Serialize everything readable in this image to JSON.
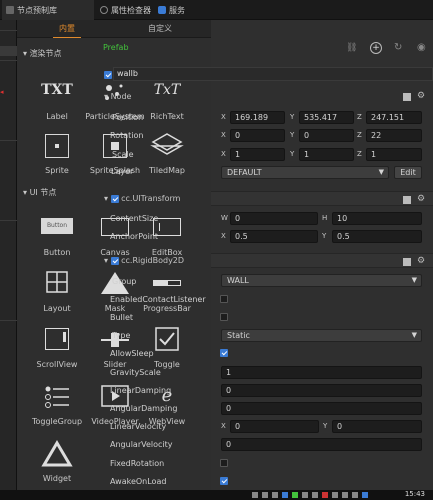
{
  "tabs": {
    "node_library": "节点预制库",
    "inspector": "属性检查器",
    "service": "服务"
  },
  "library": {
    "tabs": [
      "内置",
      "自定义"
    ],
    "prefab_label": "Prefab",
    "render_section": "渲染节点",
    "ui_section": "UI 节点",
    "render_nodes": [
      "Label",
      "ParticleSystem",
      "RichText",
      "Sprite",
      "SpriteSplash",
      "TiledMap"
    ],
    "ui_nodes": [
      "Button",
      "Canvas",
      "EditBox",
      "Layout",
      "Mask",
      "ProgressBar",
      "ScrollView",
      "Slider",
      "Toggle",
      "ToggleGroup",
      "VideoPlayer",
      "WebView",
      "Widget"
    ],
    "glyphs": {
      "label": "TXT",
      "richtext": "TxT",
      "button": "Button"
    }
  },
  "inspector": {
    "node_name": "wallb",
    "node_section": "Node",
    "props": {
      "position": "Position",
      "rotation": "Rotation",
      "scale": "Scale",
      "layer": "Layer",
      "content_size": "ContentSize",
      "anchor_point": "AnchorPoint",
      "group": "Group",
      "enabled_contact_listener": "EnabledContactListener",
      "bullet": "Bullet",
      "type": "Type",
      "allow_sleep": "AllowSleep",
      "gravity_scale": "GravityScale",
      "linear_damping": "LinearDamping",
      "angular_damping": "AngularDamping",
      "linear_velocity": "LinearVelocity",
      "angular_velocity": "AngularVelocity",
      "fixed_rotation": "FixedRotation",
      "awake_on_load": "AwakeOnLoad"
    },
    "axes": {
      "x": "X",
      "y": "Y",
      "z": "Z",
      "w": "W",
      "h": "H"
    },
    "position": {
      "x": "169.189",
      "y": "535.417",
      "z": "247.151"
    },
    "rotation": {
      "x": "0",
      "y": "0",
      "z": "22"
    },
    "scale": {
      "x": "1",
      "y": "1",
      "z": "1"
    },
    "layer": {
      "value": "DEFAULT",
      "edit": "Edit"
    },
    "uitransform": {
      "title": "cc.UITransform",
      "content_w": "0",
      "content_h": "10",
      "anchor_x": "0.5",
      "anchor_y": "0.5"
    },
    "rigidbody": {
      "title": "cc.RigidBody2D",
      "group": "WALL",
      "type": "Static",
      "gravity_scale": "1",
      "linear_damping": "0",
      "angular_damping": "0",
      "linear_velocity_x": "0",
      "linear_velocity_y": "0",
      "angular_velocity": "0"
    }
  },
  "taskbar": {
    "time": "15:43"
  },
  "colors": {
    "accent_orange": "#e08a2c",
    "prefab_green": "#43c23c",
    "check_blue": "#3a7bd5"
  }
}
